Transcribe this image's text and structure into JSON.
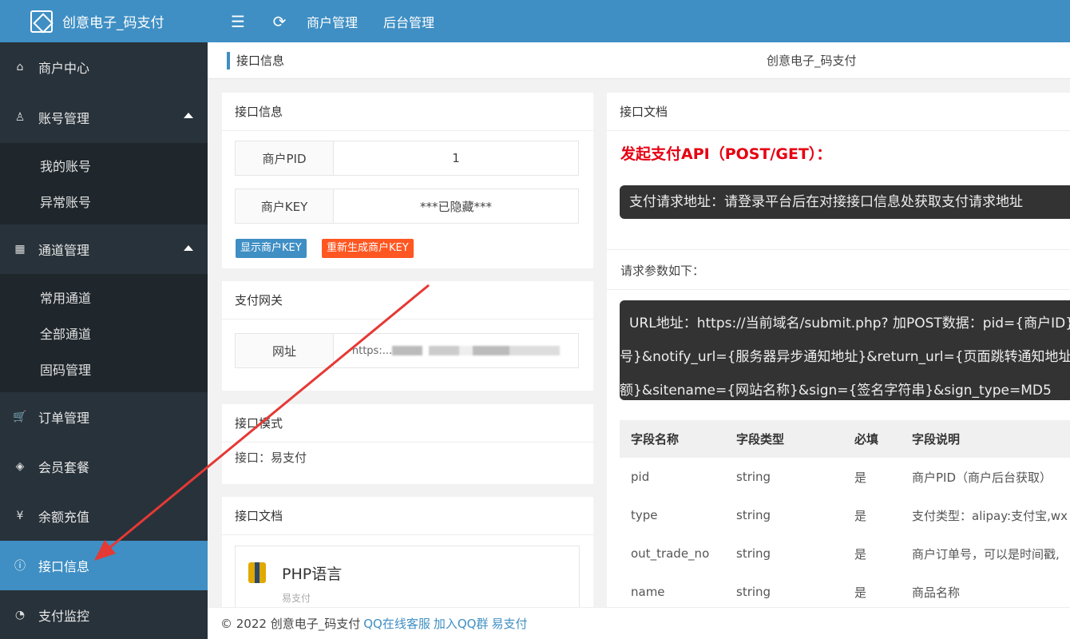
{
  "app": {
    "title": "创意电子_码支付"
  },
  "topnav": {
    "menu_icon": "☰",
    "refresh_icon": "⟳",
    "links": [
      "商户管理",
      "后台管理"
    ]
  },
  "sidebar": {
    "items": [
      {
        "label": "商户中心",
        "icon": "⌂"
      },
      {
        "label": "账号管理",
        "icon": "♙"
      },
      {
        "label": "通道管理",
        "icon": "▦"
      },
      {
        "label": "订单管理",
        "icon": "🛒"
      },
      {
        "label": "会员套餐",
        "icon": "◈"
      },
      {
        "label": "余额充值",
        "icon": "¥"
      },
      {
        "label": "接口信息",
        "icon": "ⓘ"
      },
      {
        "label": "支付监控",
        "icon": "◔"
      }
    ],
    "account_sub": [
      "我的账号",
      "异常账号"
    ],
    "channel_sub": [
      "常用通道",
      "全部通道",
      "固码管理"
    ]
  },
  "tabs": {
    "active": "接口信息",
    "center_title": "创意电子_码支付"
  },
  "interface_info": {
    "title": "接口信息",
    "pid_label": "商户PID",
    "pid_value": "1",
    "key_label": "商户KEY",
    "key_value": "***已隐藏***",
    "show_key_btn": "显示商户KEY",
    "regen_key_btn": "重新生成商户KEY"
  },
  "gateway": {
    "title": "支付网关",
    "url_label": "网址",
    "url_value": "https:..."
  },
  "mode": {
    "title": "接口模式",
    "text": "接口：易支付"
  },
  "docs_left": {
    "title": "接口文档",
    "php_label": "PHP语言",
    "php_sub": "易支付"
  },
  "docs_right": {
    "title": "接口文档",
    "api_title": "发起支付API（POST/GET）：",
    "request_url_note": "支付请求地址：请登录平台后在对接接口信息处获取支付请求地址",
    "params_intro": "请求参数如下：",
    "url_line1": "URL地址：https://当前域名/submit.php? 加POST数据：pid={商户ID}&",
    "url_line2": "号}&notify_url={服务器异步通知地址}&return_url={页面跳转通知地址}&",
    "url_line3": "额}&sitename={网站名称}&sign={签名字符串}&sign_type=MD5",
    "table": {
      "headers": [
        "字段名称",
        "字段类型",
        "必填",
        "字段说明"
      ],
      "rows": [
        [
          "pid",
          "string",
          "是",
          "商户PID（商户后台获取）"
        ],
        [
          "type",
          "string",
          "是",
          "支付类型：alipay:支付宝,wx"
        ],
        [
          "out_trade_no",
          "string",
          "是",
          "商户订单号，可以是时间戳,"
        ],
        [
          "name",
          "string",
          "是",
          "商品名称"
        ]
      ]
    }
  },
  "footer": {
    "copyright": "© 2022 创意电子_码支付",
    "links": [
      "QQ在线客服",
      "加入QQ群",
      "易支付"
    ]
  },
  "colors": {
    "primary": "#3f8fc4",
    "danger": "#ff5722",
    "sidebar": "#28323a",
    "arrow": "#e53935"
  }
}
